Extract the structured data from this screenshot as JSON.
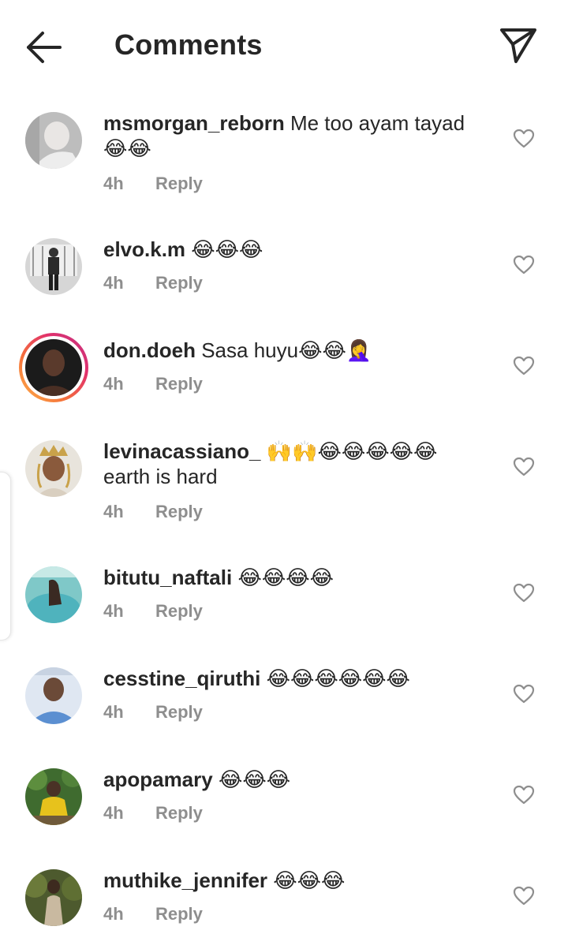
{
  "header": {
    "title": "Comments",
    "back_icon": "arrow-left-icon",
    "send_icon": "paper-plane-icon"
  },
  "comments": [
    {
      "username": "msmorgan_reborn",
      "text": "Me too ayam tayad 😂😂",
      "time": "4h",
      "reply": "Reply"
    },
    {
      "username": "elvo.k.m",
      "text": "😂😂😂",
      "time": "4h",
      "reply": "Reply"
    },
    {
      "username": "don.doeh",
      "text": "Sasa huyu😂😂🤦‍♀️",
      "time": "4h",
      "reply": "Reply"
    },
    {
      "username": "levinacassiano_",
      "text": "🙌🙌😂😂😂😂😂 earth is hard",
      "time": "4h",
      "reply": "Reply"
    },
    {
      "username": "bitutu_naftali",
      "text": "😂😂😂😂",
      "time": "4h",
      "reply": "Reply"
    },
    {
      "username": "cesstine_qiruthi",
      "text": "😂😂😂😂😂😂",
      "time": "4h",
      "reply": "Reply"
    },
    {
      "username": "apopamary",
      "text": "😂😂😂",
      "time": "4h",
      "reply": "Reply"
    },
    {
      "username": "muthike_jennifer",
      "text": "😂😂😂",
      "time": "4h",
      "reply": "Reply"
    }
  ],
  "colors": {
    "text": "#262626",
    "secondary": "#8e8e8e",
    "story_ring_start": "#fdb44b",
    "story_ring_end": "#c13584"
  }
}
